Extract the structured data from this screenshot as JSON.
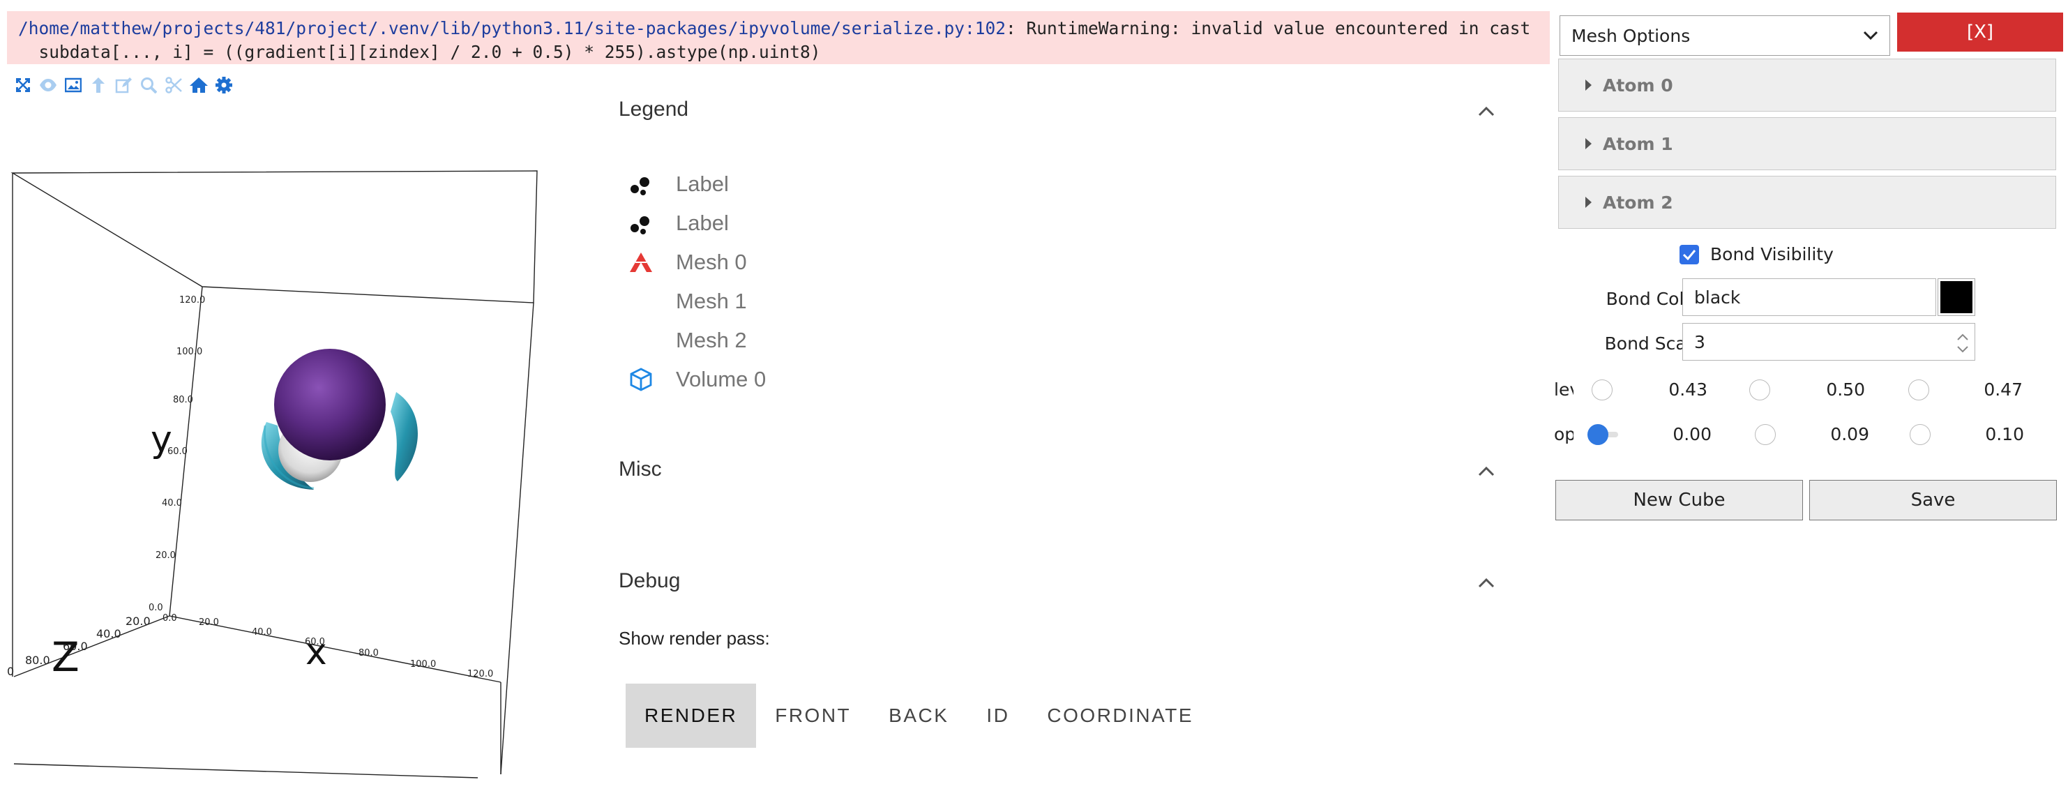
{
  "warning": {
    "path": "/home/matthew/projects/481/project/.venv/lib/python3.11/site-packages/ipyvolume/serialize.py:102",
    "message": ": RuntimeWarning: invalid value encountered in cast",
    "code": "  subdata[..., i] = ((gradient[i][zindex] / 2.0 + 0.5) * 255).astype(np.uint8)"
  },
  "toolbar": {
    "icons": [
      "fullscreen-icon",
      "eye-icon",
      "image-icon",
      "arrow-up-icon",
      "pencil-icon",
      "zoom-icon",
      "scissors-icon",
      "home-icon",
      "gear-icon"
    ]
  },
  "plot": {
    "y_label": "y",
    "x_label": "x",
    "z_label": "z",
    "y_ticks": [
      "120.0",
      "100.0",
      "80.0",
      "60.0",
      "40.0",
      "20.0",
      "0.0"
    ],
    "x_ticks": [
      "0.0",
      "20.0",
      "40.0",
      "60.0",
      "80.0",
      "100.0",
      "120.0"
    ],
    "z_ticks": [
      "20.0",
      "40.0",
      "60.0",
      "80.0",
      "0"
    ]
  },
  "legend": {
    "title": "Legend",
    "items": [
      {
        "label": "Label",
        "icon": "scatter-icon"
      },
      {
        "label": "Label",
        "icon": "scatter-icon"
      },
      {
        "label": "Mesh 0",
        "icon": "mesh-icon"
      },
      {
        "label": "Mesh 1",
        "icon": ""
      },
      {
        "label": "Mesh 2",
        "icon": ""
      },
      {
        "label": "Volume 0",
        "icon": "cube-icon"
      }
    ]
  },
  "misc": {
    "title": "Misc"
  },
  "debug": {
    "title": "Debug",
    "render_pass_label": "Show render pass:",
    "passes": [
      "RENDER",
      "FRONT",
      "BACK",
      "ID",
      "COORDINATE"
    ],
    "active": "RENDER"
  },
  "side": {
    "dropdown_value": "Mesh Options",
    "close_label": "[X]",
    "atoms": [
      "Atom 0",
      "Atom 1",
      "Atom 2"
    ],
    "bond_visibility_label": "Bond Visibility",
    "bond_visibility_checked": true,
    "bond_color_label": "Bond Color",
    "bond_color_value": "black",
    "bond_color_swatch": "#000000",
    "bond_scale_label": "Bond Scale",
    "bond_scale_value": "3",
    "level_label": "lev",
    "opacity_label": "opa",
    "levels": [
      "0.43",
      "0.50",
      "0.47"
    ],
    "opacities": [
      "0.00",
      "0.09",
      "0.10"
    ],
    "new_cube_label": "New Cube",
    "save_label": "Save"
  },
  "colors": {
    "warning_bg": "#fddddd",
    "close_button": "#d32f2f",
    "accent": "#2f78e0",
    "sphere": "#5a2a82",
    "mesh_icon": "#e53935",
    "cube_icon": "#1e88e5"
  }
}
